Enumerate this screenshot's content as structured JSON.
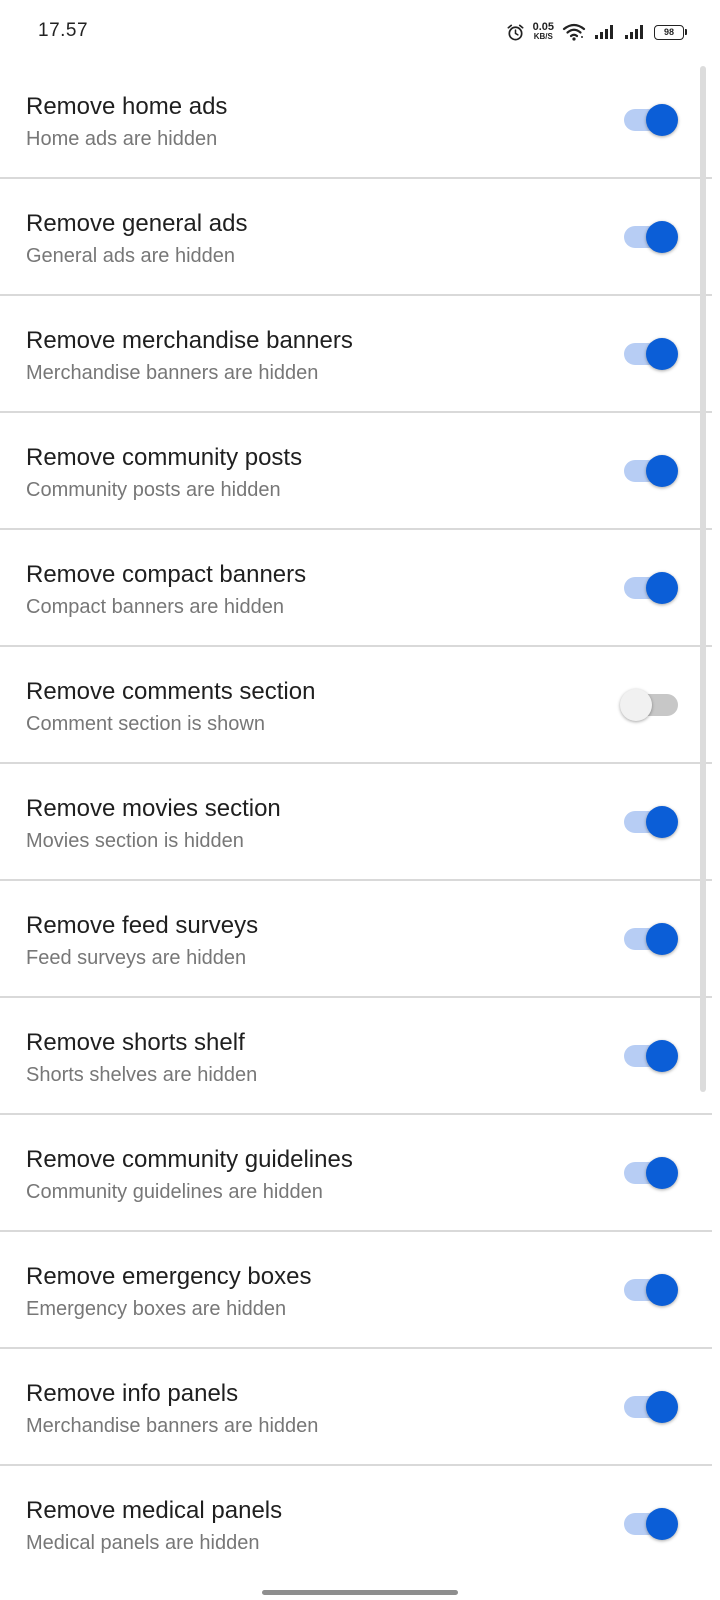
{
  "status_bar": {
    "time": "17.57",
    "net_speed_value": "0.05",
    "net_speed_unit": "KB/S",
    "battery": "98",
    "icons": [
      "alarm-icon",
      "wifi-icon",
      "signal-icon",
      "signal-icon"
    ]
  },
  "colors": {
    "accent": "#0b5ed7",
    "accent_track": "#b7cdf4",
    "off_track": "#c7c7c7",
    "off_thumb": "#f1f1f1"
  },
  "settings": [
    {
      "title": "Remove home ads",
      "summary": "Home ads are hidden",
      "enabled": true
    },
    {
      "title": "Remove general ads",
      "summary": "General ads are hidden",
      "enabled": true
    },
    {
      "title": "Remove merchandise banners",
      "summary": "Merchandise banners are hidden",
      "enabled": true
    },
    {
      "title": "Remove community posts",
      "summary": "Community posts are hidden",
      "enabled": true
    },
    {
      "title": "Remove compact banners",
      "summary": "Compact banners are hidden",
      "enabled": true
    },
    {
      "title": "Remove comments section",
      "summary": "Comment section is shown",
      "enabled": false
    },
    {
      "title": "Remove movies section",
      "summary": "Movies section is hidden",
      "enabled": true
    },
    {
      "title": "Remove feed surveys",
      "summary": "Feed surveys are hidden",
      "enabled": true
    },
    {
      "title": "Remove shorts shelf",
      "summary": "Shorts shelves are hidden",
      "enabled": true
    },
    {
      "title": "Remove community guidelines",
      "summary": "Community guidelines are hidden",
      "enabled": true
    },
    {
      "title": "Remove emergency boxes",
      "summary": "Emergency boxes are hidden",
      "enabled": true
    },
    {
      "title": "Remove info panels",
      "summary": "Merchandise banners are hidden",
      "enabled": true
    },
    {
      "title": "Remove medical panels",
      "summary": "Medical panels are hidden",
      "enabled": true
    }
  ]
}
